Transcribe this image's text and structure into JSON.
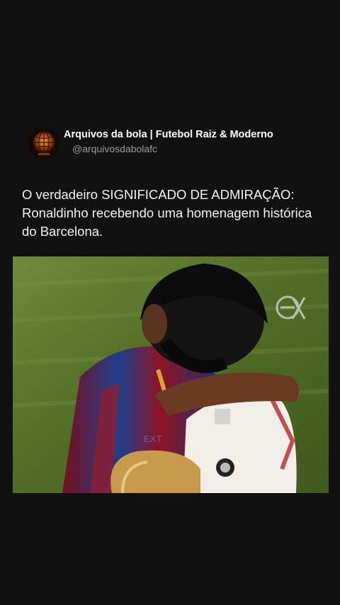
{
  "post": {
    "author_name": "Arquivos da bola | Futebol Raiz & Moderno",
    "author_handle": "@arquivosdabolafc",
    "text": "O verdadeiro SIGNIFICADO DE ADMIRAÇÃO: Ronaldinho recebendo uma homenagem histórica do Barcelona."
  },
  "media": {
    "watermark_icon": "ex-logo-icon",
    "shirt_text": "EXT"
  },
  "colors": {
    "background": "#111111",
    "text_primary": "#ffffff",
    "text_secondary": "#9a9a9a",
    "accent_orange": "#e0731c"
  }
}
